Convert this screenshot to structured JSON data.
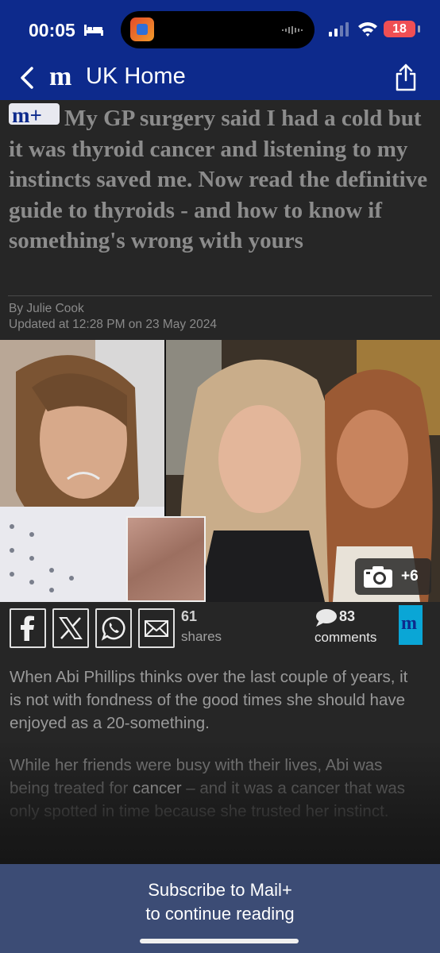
{
  "status_bar": {
    "time": "00:05",
    "battery": "18"
  },
  "nav": {
    "back_label": "UK Home",
    "logo_glyph": "m"
  },
  "article": {
    "badge": "m+",
    "headline": "My GP surgery said I had a cold but it was thyroid cancer and listening to my instincts saved me. Now read the definitive guide to thyroids - and how to know if something's wrong with yours",
    "byline": "By Julie Cook",
    "updated": "Updated at 12:28 PM on 23 May 2024"
  },
  "gallery": {
    "count_label": "+6"
  },
  "share": {
    "buttons": [
      "facebook",
      "x",
      "whatsapp",
      "email"
    ],
    "count": "61",
    "count_label": "shares",
    "comments_count": "83",
    "comments_label": "comments",
    "badge_glyph": "m"
  },
  "body": {
    "para1": "When Abi Phillips thinks over the last couple of years, it is not with fondness of the good times she should have enjoyed as a 20-something.",
    "para2_a": "While her friends were busy with their lives, Abi was being treated for ",
    "para2_link": "cancer",
    "para2_b": " – and it was a cancer that was only spotted in time because she trusted her instinct."
  },
  "paywall": {
    "line1": "Subscribe to Mail+",
    "line2": "to continue reading"
  },
  "colors": {
    "header_bg": "#0d2a8c",
    "paywall_bg": "#3c4c75",
    "page_bg": "#262626",
    "badge": "#0aa6d6",
    "battery": "#ef4f54"
  }
}
